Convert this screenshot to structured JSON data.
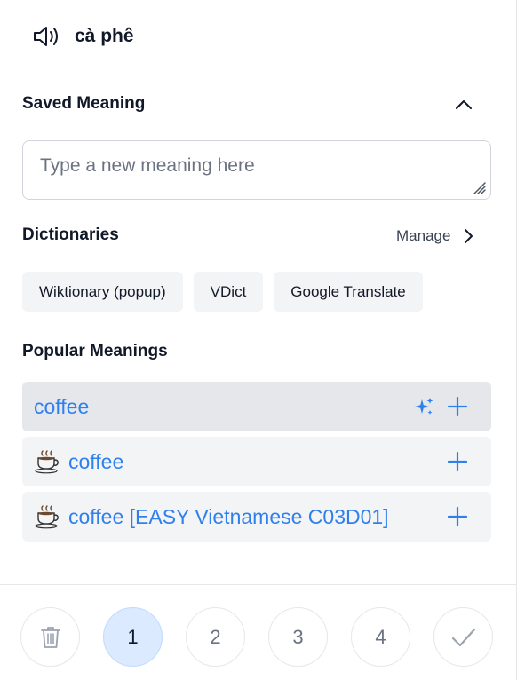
{
  "header": {
    "word": "cà phê",
    "audio_icon": "speaker-icon"
  },
  "saved_meaning": {
    "title": "Saved Meaning",
    "toggle_icon": "chevron-up-icon",
    "placeholder": "Type a new meaning here",
    "value": ""
  },
  "dictionaries": {
    "title": "Dictionaries",
    "manage_label": "Manage",
    "items": [
      "Wiktionary (popup)",
      "VDict",
      "Google Translate"
    ]
  },
  "popular_meanings": {
    "title": "Popular Meanings",
    "items": [
      {
        "text": "coffee",
        "icon": "",
        "actions": [
          "sparkle-icon",
          "plus-icon"
        ]
      },
      {
        "text": "coffee",
        "icon": "coffee-cup-icon",
        "actions": [
          "plus-icon"
        ]
      },
      {
        "text": "coffee [EASY Vietnamese C03D01]",
        "icon": "coffee-cup-icon",
        "actions": [
          "plus-icon"
        ]
      }
    ]
  },
  "footer": {
    "delete_icon": "trash-icon",
    "levels": [
      "1",
      "2",
      "3",
      "4"
    ],
    "active_level": "1",
    "confirm_icon": "check-icon"
  },
  "colors": {
    "accent_blue": "#2f80ed",
    "item_bg": "#f3f4f6",
    "active_circle_bg": "#dbeafe"
  }
}
